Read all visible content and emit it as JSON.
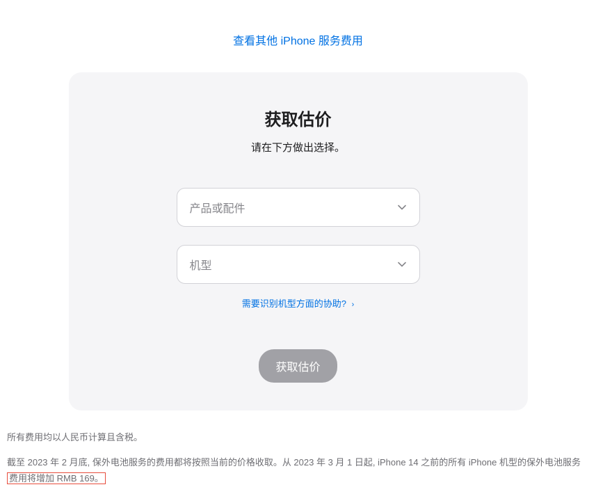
{
  "topLink": {
    "text": "查看其他 iPhone 服务费用"
  },
  "card": {
    "title": "获取估价",
    "subtitle": "请在下方做出选择。",
    "select1": {
      "placeholder": "产品或配件"
    },
    "select2": {
      "placeholder": "机型"
    },
    "helpLink": {
      "text": "需要识别机型方面的协助?"
    },
    "button": {
      "label": "获取估价"
    }
  },
  "footer": {
    "line1": "所有费用均以人民币计算且含税。",
    "line2_part1": "截至 2023 年 2 月底, 保外电池服务的费用都将按照当前的价格收取。从 2023 年 3 月 1 日起, iPhone 14 之前的所有 iPhone 机型的保外电池服务",
    "line2_highlight": "费用将增加 RMB 169。"
  }
}
